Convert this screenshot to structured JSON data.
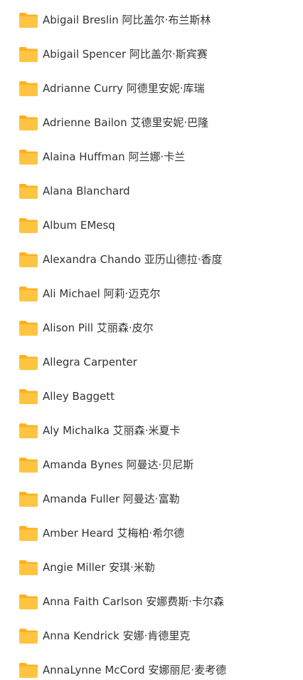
{
  "folder_icon": "folder-icon",
  "folder_color": "#FFC542",
  "folder_tab_color": "#FFB020",
  "folders": [
    {
      "name": "Abigail Breslin 阿比盖尔·布兰斯林"
    },
    {
      "name": "Abigail Spencer 阿比盖尔·斯宾赛"
    },
    {
      "name": "Adrianne Curry 阿德里安妮·库瑞"
    },
    {
      "name": "Adrienne Bailon 艾德里安妮·巴隆"
    },
    {
      "name": "Alaina Huffman 阿兰娜·卡兰"
    },
    {
      "name": "Alana Blanchard"
    },
    {
      "name": "Album EMesq"
    },
    {
      "name": "Alexandra Chando 亚历山德拉·香度"
    },
    {
      "name": "Ali Michael 阿莉·迈克尔"
    },
    {
      "name": "Alison Pill 艾丽森·皮尔"
    },
    {
      "name": "Allegra Carpenter"
    },
    {
      "name": "Alley Baggett"
    },
    {
      "name": "Aly Michalka 艾丽森·米夏卡"
    },
    {
      "name": "Amanda Bynes 阿曼达·贝尼斯"
    },
    {
      "name": "Amanda Fuller 阿曼达·富勒"
    },
    {
      "name": "Amber Heard 艾梅柏·希尔德"
    },
    {
      "name": "Angie Miller 安琪·米勒"
    },
    {
      "name": "Anna Faith Carlson 安娜费斯·卡尔森"
    },
    {
      "name": "Anna Kendrick 安娜·肯德里克"
    },
    {
      "name": "AnnaLynne McCord 安娜丽尼·麦考德"
    }
  ]
}
